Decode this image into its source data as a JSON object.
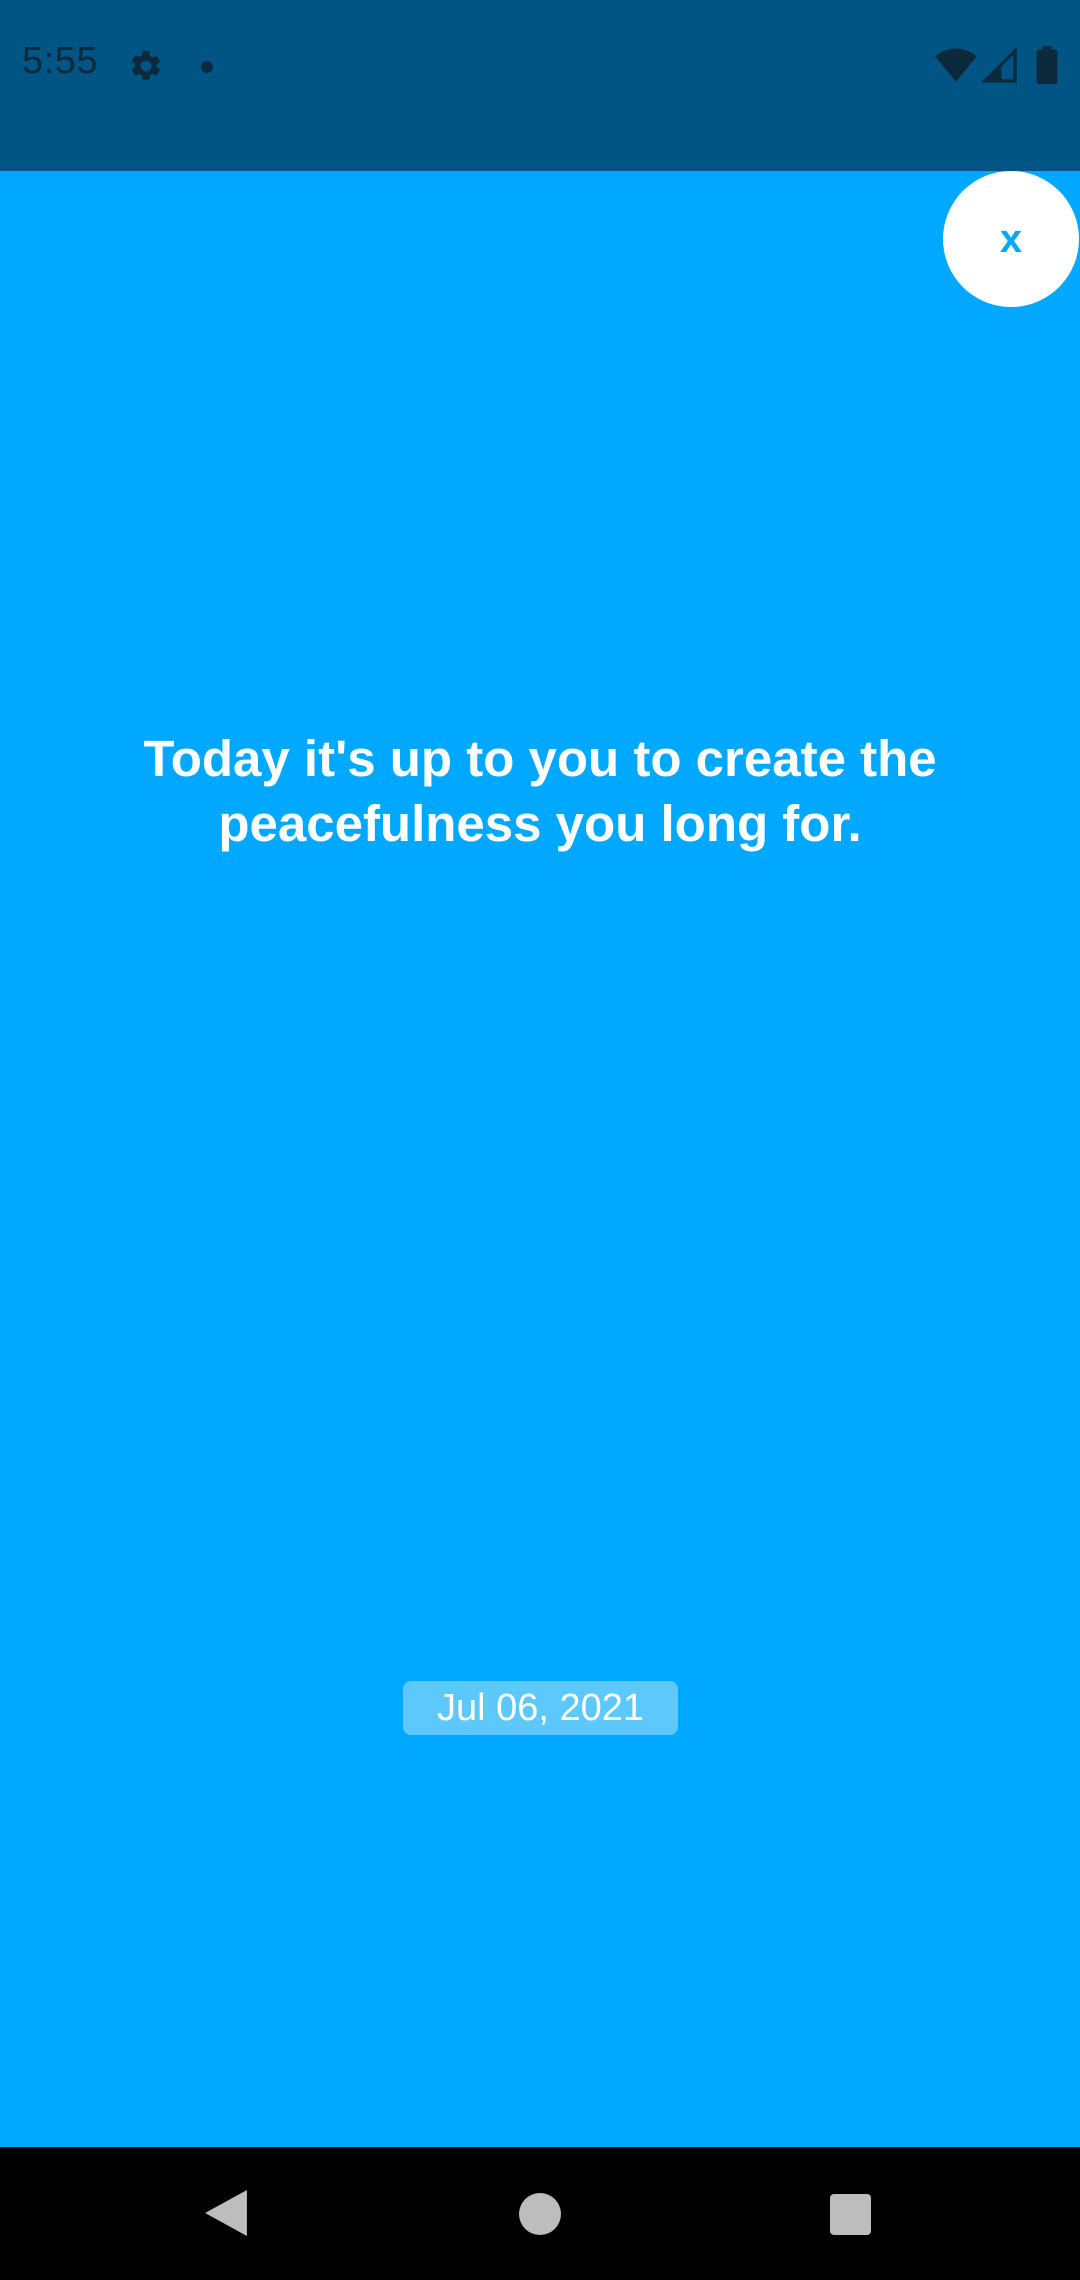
{
  "status_bar": {
    "time": "5:55",
    "icons": [
      "gear-icon",
      "notification-dot-icon",
      "wifi-icon",
      "signal-icon",
      "battery-icon"
    ]
  },
  "close_button": {
    "label": "x"
  },
  "quote": {
    "text": "Today it's up to you to create the peacefulness you long for."
  },
  "date_badge": {
    "text": "Jul 06, 2021"
  },
  "navigation": {
    "icons": [
      "back-icon",
      "home-icon",
      "recents-icon"
    ]
  },
  "colors": {
    "background": "#00A9FF",
    "status_bar": "#005585",
    "close_button_bg": "#FFFFFF",
    "date_badge_bg": "#5CC8FB",
    "nav_bar": "#000000"
  }
}
